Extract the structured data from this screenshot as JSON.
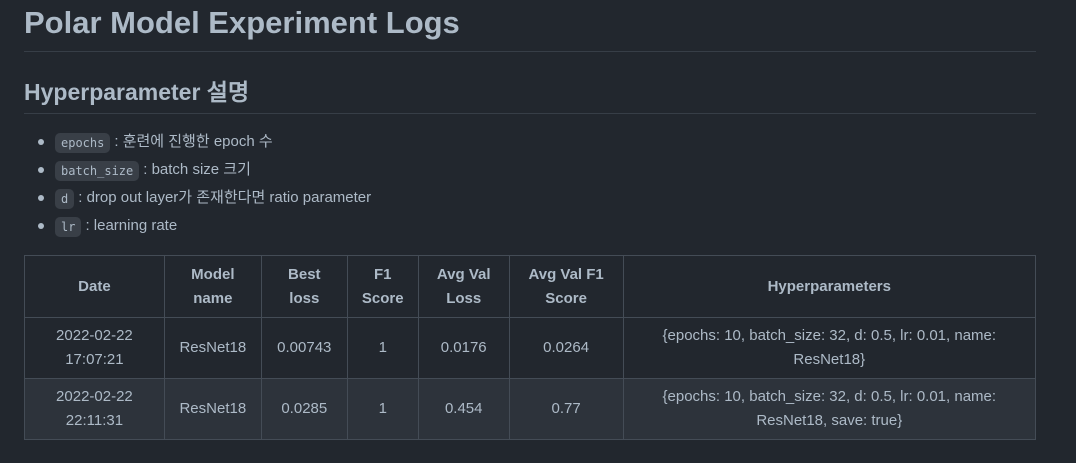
{
  "title": "Polar Model Experiment Logs",
  "section_title": "Hyperparameter 설명",
  "hyperparams": [
    {
      "code": "epochs",
      "desc": ": 훈련에 진행한 epoch 수"
    },
    {
      "code": "batch_size",
      "desc": ": batch size 크기"
    },
    {
      "code": "d",
      "desc": ": drop out layer가 존재한다면 ratio parameter"
    },
    {
      "code": "lr",
      "desc": ": learning rate"
    }
  ],
  "table": {
    "headers": [
      "Date",
      "Model name",
      "Best loss",
      "F1 Score",
      "Avg Val Loss",
      "Avg Val F1 Score",
      "Hyperparameters"
    ],
    "rows": [
      [
        "2022-02-22 17:07:21",
        "ResNet18",
        "0.00743",
        "1",
        "0.0176",
        "0.0264",
        "{epochs: 10, batch_size: 32, d: 0.5, lr: 0.01, name: ResNet18}"
      ],
      [
        "2022-02-22 22:11:31",
        "ResNet18",
        "0.0285",
        "1",
        "0.454",
        "0.77",
        "{epochs: 10, batch_size: 32, d: 0.5, lr: 0.01, name: ResNet18, save: true}"
      ]
    ]
  }
}
